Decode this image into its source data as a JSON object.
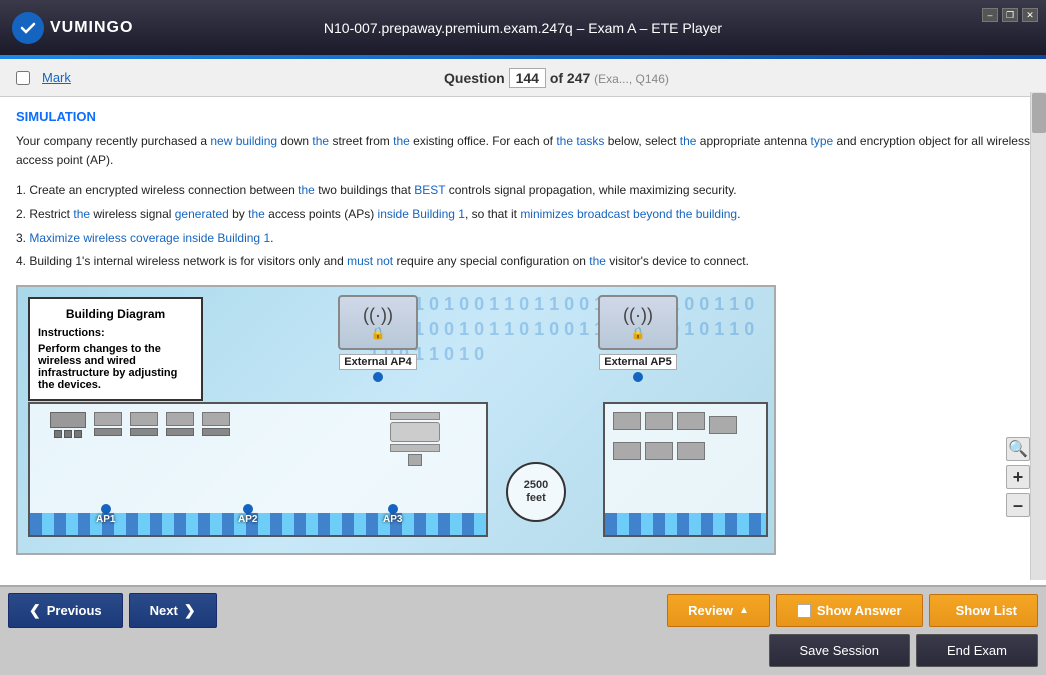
{
  "titlebar": {
    "logo_text": "VUMINGO",
    "title": "N10-007.prepaway.premium.exam.247q – Exam A – ETE Player",
    "win_min": "–",
    "win_restore": "❐",
    "win_close": "✕"
  },
  "question_header": {
    "mark_label": "Mark",
    "question_label": "Question",
    "question_number": "144",
    "of_label": "of 247",
    "sub_label": "(Exa..., Q146)"
  },
  "content": {
    "sim_label": "SIMULATION",
    "intro": "Your company recently purchased a new building down the street from the existing office. For each of the tasks below, select the appropriate antenna type and encryption object for all wireless access point (AP).",
    "tasks": [
      "1. Create an encrypted wireless connection between the two buildings that BEST controls signal propagation, while maximizing security.",
      "2. Restrict the wireless signal generated by the access points (APs) inside Building 1, so that it minimizes broadcast beyond the building.",
      "3. Maximize wireless coverage inside Building 1.",
      "4. Building 1's internal wireless network is for visitors only and must not require any special configuration on the visitor's device to connect."
    ],
    "diagram": {
      "title": "Building Diagram",
      "instructions_title": "Instructions:",
      "instructions_text": "Perform changes to the wireless and wired infrastructure by adjusting the devices.",
      "external_ap4": "External AP4",
      "external_ap5": "External AP5",
      "ap1": "AP1",
      "ap2": "AP2",
      "ap3": "AP3",
      "distance": "2500",
      "distance_unit": "feet"
    }
  },
  "buttons": {
    "previous": "Previous",
    "next": "Next",
    "review": "Review",
    "show_answer": "Show Answer",
    "show_list": "Show List",
    "save_session": "Save Session",
    "end_exam": "End Exam"
  },
  "zoom": {
    "search": "🔍",
    "zoom_in": "+",
    "zoom_out": "–"
  }
}
